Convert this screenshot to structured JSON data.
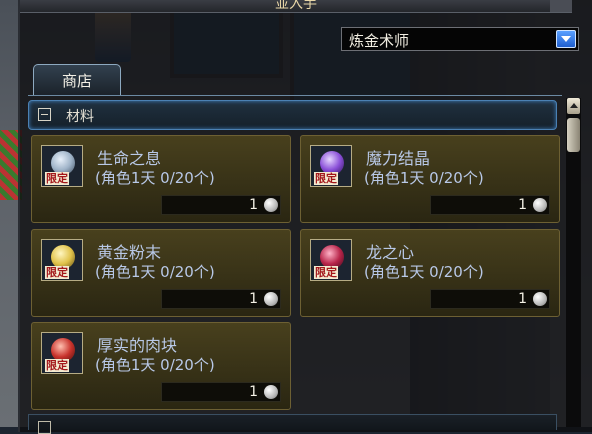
{
  "window": {
    "title": "並入手"
  },
  "category_select": {
    "value": "炼金术师"
  },
  "tabs": [
    {
      "label": "商店"
    }
  ],
  "section": {
    "label": "材料"
  },
  "items": [
    {
      "name": "生命之息",
      "limit": "(角色1天 0/20个)",
      "price": "1",
      "badge": "限定",
      "icon": "flask-icon",
      "color": "#9fb3c8"
    },
    {
      "name": "魔力结晶",
      "limit": "(角色1天 0/20个)",
      "price": "1",
      "badge": "限定",
      "icon": "crystal-icon",
      "color": "#8a4fd8"
    },
    {
      "name": "黄金粉末",
      "limit": "(角色1天 0/20个)",
      "price": "1",
      "badge": "限定",
      "icon": "gold-dust-icon",
      "color": "#e0c24a"
    },
    {
      "name": "龙之心",
      "limit": "(角色1天 0/20个)",
      "price": "1",
      "badge": "限定",
      "icon": "dragon-heart-icon",
      "color": "#b8254a"
    },
    {
      "name": "厚实的肉块",
      "limit": "(角色1天 0/20个)",
      "price": "1",
      "badge": "限定",
      "icon": "meat-icon",
      "color": "#c8332c"
    }
  ]
}
